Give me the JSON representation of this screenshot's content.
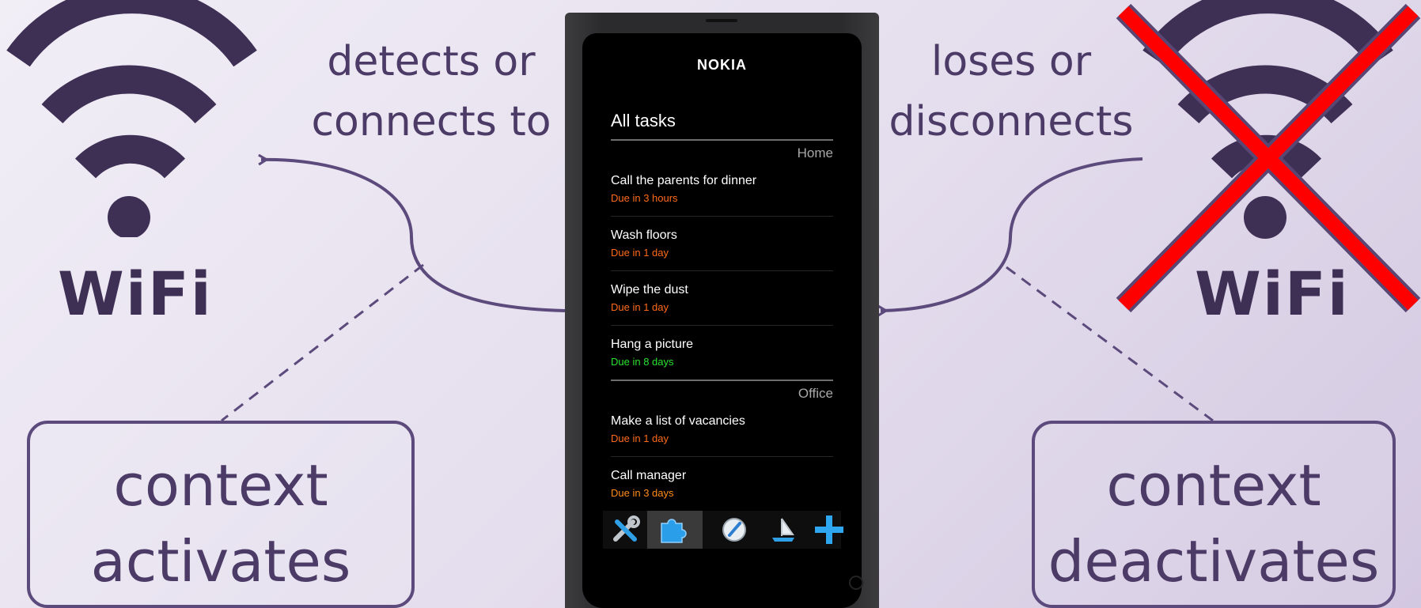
{
  "left": {
    "caption_line1": "detects or",
    "caption_line2": "connects to",
    "wifi_label": "WiFi",
    "context_line1": "context",
    "context_line2": "activates"
  },
  "right": {
    "caption_line1": "loses or",
    "caption_line2": "disconnects",
    "wifi_label": "WiFi",
    "context_line1": "context",
    "context_line2": "deactivates"
  },
  "phone": {
    "brand": "NOKIA",
    "list_title": "All tasks",
    "groups": [
      {
        "name": "Home",
        "tasks": [
          {
            "title": "Call the parents for dinner",
            "due": "Due in 3 hours",
            "due_color": "#ff6a1a"
          },
          {
            "title": "Wash floors",
            "due": "Due in 1 day",
            "due_color": "#ff6a1a"
          },
          {
            "title": "Wipe the dust",
            "due": "Due in 1 day",
            "due_color": "#ff6a1a"
          },
          {
            "title": "Hang a picture",
            "due": "Due in 8 days",
            "due_color": "#29e32f"
          }
        ]
      },
      {
        "name": "Office",
        "tasks": [
          {
            "title": "Make a list of vacancies",
            "due": "Due in 1 day",
            "due_color": "#ff6a1a"
          },
          {
            "title": "Call manager",
            "due": "Due in 3 days",
            "due_color": "#ff8c1a"
          }
        ]
      }
    ],
    "toolbar_icons": [
      "tools-icon",
      "puzzle-icon",
      "compass-icon",
      "sailboat-icon",
      "plus-icon"
    ]
  },
  "colors": {
    "accent": "#4b3b66",
    "cross": "#ff0000"
  }
}
